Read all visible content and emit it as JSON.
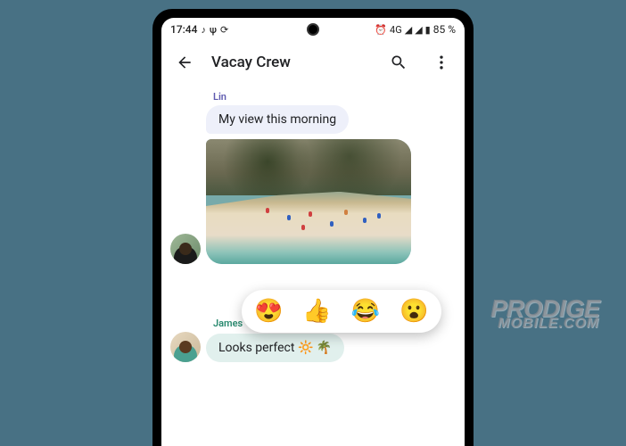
{
  "statusbar": {
    "time": "17:44",
    "network_label": "4G",
    "battery_text": "85 %"
  },
  "appbar": {
    "title": "Vacay Crew"
  },
  "messages": {
    "lin": {
      "name": "Lin",
      "text": "My view this morning"
    },
    "james": {
      "name": "James",
      "text": "Looks perfect 🔆 🌴"
    }
  },
  "reactions": [
    "😍",
    "👍",
    "😂",
    "😮"
  ],
  "watermark": {
    "line1": "PRODIGE",
    "line2": "MOBILE.COM"
  }
}
